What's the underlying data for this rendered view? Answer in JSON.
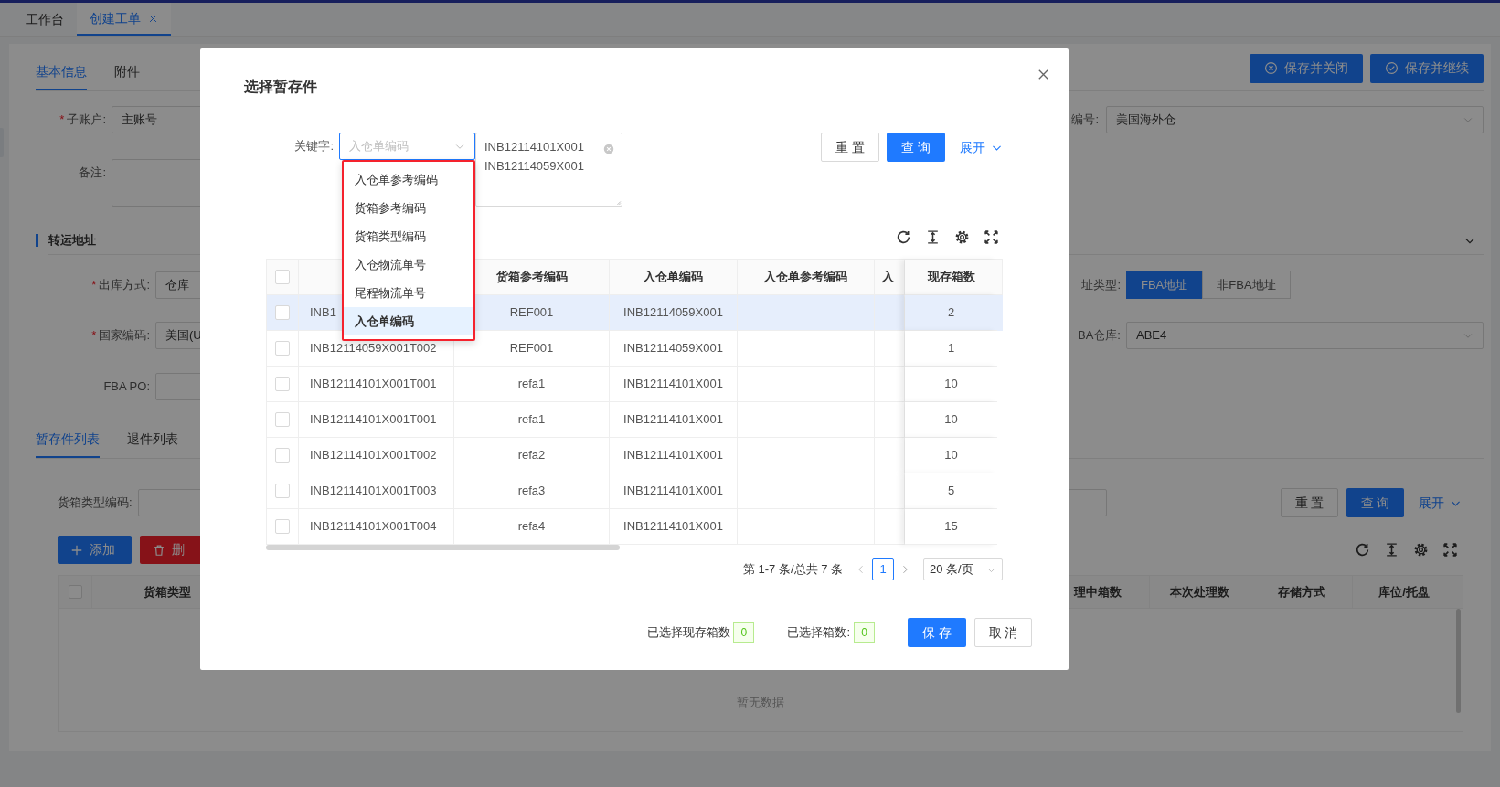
{
  "top_tabs": [
    {
      "label": "工作台",
      "selected": false,
      "closable": false
    },
    {
      "label": "创建工单",
      "selected": true,
      "closable": true
    }
  ],
  "form_tabs": [
    {
      "label": "基本信息",
      "selected": true
    },
    {
      "label": "附件",
      "selected": false
    }
  ],
  "header_buttons": [
    {
      "label": "保存并关闭",
      "kind": "close"
    },
    {
      "label": "保存并继续",
      "kind": "check"
    }
  ],
  "account": {
    "label": "子账户:",
    "required_mark": "*",
    "value": "主账号"
  },
  "warehouse": {
    "label": "编号:",
    "value": "美国海外仓"
  },
  "remark": {
    "label": "备注:"
  },
  "transfer": {
    "title": "转运地址"
  },
  "method": {
    "label": "出库方式:",
    "required_mark": "*",
    "value": "仓库"
  },
  "address_type": {
    "label": "址类型:",
    "options": [
      {
        "label": "FBA地址",
        "selected": true
      },
      {
        "label": "非FBA地址",
        "selected": false
      }
    ]
  },
  "country": {
    "label": "国家编码:",
    "required_mark": "*",
    "value": "美国(U"
  },
  "fba_warehouse": {
    "label": "BA仓库:",
    "value": "ABE4"
  },
  "fba_po": {
    "label": "FBA PO:"
  },
  "list_tabs": [
    {
      "label": "暂存件列表",
      "selected": true
    },
    {
      "label": "退件列表",
      "selected": false
    }
  ],
  "list_filter": {
    "label": "货箱类型编码:",
    "reset": "重 置",
    "query": "查 询",
    "expand": "展开"
  },
  "list_actions": [
    {
      "label": "添加",
      "kind": "add"
    },
    {
      "label": "删",
      "kind": "delete"
    }
  ],
  "list_table": {
    "all_checked": false,
    "columns_left": [
      "货箱类型"
    ],
    "columns_right": [
      "理中箱数",
      "本次处理数",
      "存储方式",
      "库位/托盘"
    ],
    "empty_text": "暂无数据"
  },
  "dialog": {
    "title": "选择暂存件",
    "keyword_label": "关键字:",
    "keyword_placeholder": "入仓单编码",
    "keyword_values": "INB12114101X001\nINB12114059X001",
    "keyword_options": [
      {
        "label": "入仓单参考编码",
        "selected": false
      },
      {
        "label": "货箱参考编码",
        "selected": false
      },
      {
        "label": "货箱类型编码",
        "selected": false
      },
      {
        "label": "入仓物流单号",
        "selected": false
      },
      {
        "label": "尾程物流单号",
        "selected": false
      },
      {
        "label": "入仓单编码",
        "selected": true
      }
    ],
    "reset": "重 置",
    "query": "查 询",
    "expand": "展开",
    "table": {
      "all_checked": false,
      "columns": [
        "货箱参考编码",
        "入仓单编码",
        "入仓单参考编码",
        "入",
        "现存箱数"
      ],
      "rows": [
        {
          "checked": false,
          "highlighted": true,
          "box_code": "INB1",
          "box_ref": "REF001",
          "inbound_code": "INB12114059X001",
          "count": "2"
        },
        {
          "checked": false,
          "highlighted": false,
          "box_code": "INB12114059X001T002",
          "box_ref": "REF001",
          "inbound_code": "INB12114059X001",
          "count": "1"
        },
        {
          "checked": false,
          "highlighted": false,
          "box_code": "INB12114101X001T001",
          "box_ref": "refa1",
          "inbound_code": "INB12114101X001",
          "count": "10"
        },
        {
          "checked": false,
          "highlighted": false,
          "box_code": "INB12114101X001T001",
          "box_ref": "refa1",
          "inbound_code": "INB12114101X001",
          "count": "10"
        },
        {
          "checked": false,
          "highlighted": false,
          "box_code": "INB12114101X001T002",
          "box_ref": "refa2",
          "inbound_code": "INB12114101X001",
          "count": "10"
        },
        {
          "checked": false,
          "highlighted": false,
          "box_code": "INB12114101X001T003",
          "box_ref": "refa3",
          "inbound_code": "INB12114101X001",
          "count": "5"
        },
        {
          "checked": false,
          "highlighted": false,
          "box_code": "INB12114101X001T004",
          "box_ref": "refa4",
          "inbound_code": "INB12114101X001",
          "count": "15"
        }
      ]
    },
    "pagination": {
      "summary": "第 1-7 条/总共 7 条",
      "pages": [
        {
          "label": "1",
          "selected": true
        }
      ],
      "page_size": "20 条/页"
    },
    "footer": {
      "stock_label": "已选择现存箱数",
      "stock_count": "0",
      "box_label": "已选择箱数:",
      "box_count": "0",
      "save": "保 存",
      "cancel": "取 消"
    }
  }
}
